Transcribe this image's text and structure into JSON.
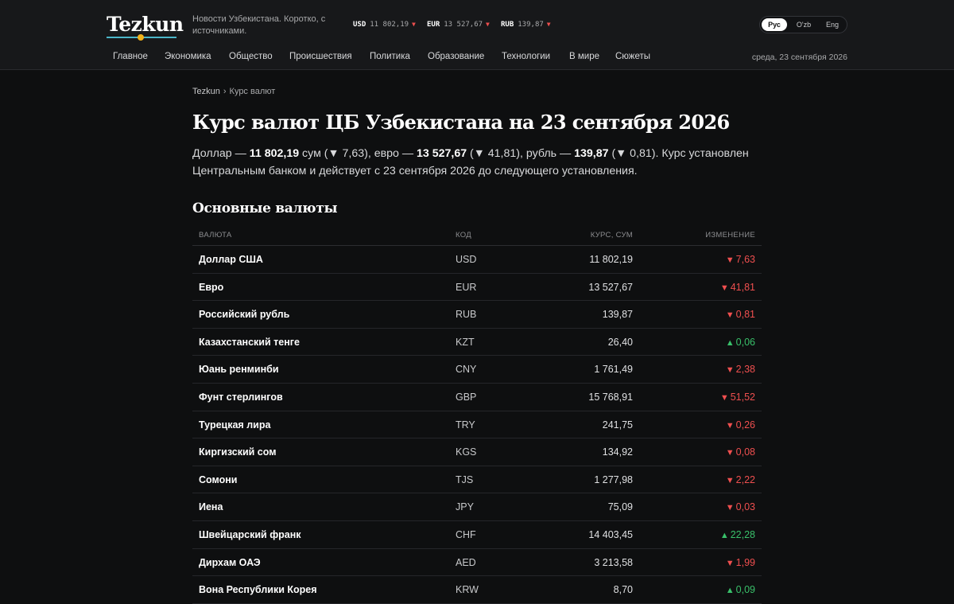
{
  "header": {
    "logo": "Tezkun",
    "tagline": "Новости Узбекистана. Коротко, с источниками.",
    "ticker": [
      {
        "code": "USD",
        "value": "11 802,19",
        "arrow": "▼"
      },
      {
        "code": "EUR",
        "value": "13 527,67",
        "arrow": "▼"
      },
      {
        "code": "RUB",
        "value": "139,87",
        "arrow": "▼"
      }
    ],
    "languages": [
      "Рус",
      "O'zb",
      "Eng"
    ],
    "active_language": "Рус",
    "nav": [
      "Главное",
      "Экономика",
      "Общество",
      "Происшествия",
      "Политика",
      "Образование",
      "Технологии",
      "В мире",
      "Сюжеты"
    ],
    "date": "среда, 23 сентября 2026"
  },
  "breadcrumb": {
    "home": "Tezkun",
    "separator": "›",
    "current": "Курс валют"
  },
  "page": {
    "title": "Курс валют ЦБ Узбекистана на 23 сентября 2026",
    "lead": {
      "p1": "Доллар — ",
      "usd": "11 802,19",
      "p2": " сум (▼ 7,63), евро — ",
      "eur": "13 527,67",
      "p3": " (▼ 41,81), рубль — ",
      "rub": "139,87",
      "p4": " (▼ 0,81). Курс установлен Центральным банком и действует с 23 сентября 2026 до следующего установления."
    },
    "section_title": "Основные валюты"
  },
  "table": {
    "headers": {
      "currency": "ВАЛЮТА",
      "code": "КОД",
      "rate": "КУРС, СУМ",
      "change": "ИЗМЕНЕНИЕ"
    },
    "rows": [
      {
        "name": "Доллар США",
        "code": "USD",
        "rate": "11 802,19",
        "dir": "down",
        "arrow": "▼",
        "change": "7,63"
      },
      {
        "name": "Евро",
        "code": "EUR",
        "rate": "13 527,67",
        "dir": "down",
        "arrow": "▼",
        "change": "41,81"
      },
      {
        "name": "Российский рубль",
        "code": "RUB",
        "rate": "139,87",
        "dir": "down",
        "arrow": "▼",
        "change": "0,81"
      },
      {
        "name": "Казахстанский тенге",
        "code": "KZT",
        "rate": "26,40",
        "dir": "up",
        "arrow": "▲",
        "change": "0,06"
      },
      {
        "name": "Юань ренминби",
        "code": "CNY",
        "rate": "1 761,49",
        "dir": "down",
        "arrow": "▼",
        "change": "2,38"
      },
      {
        "name": "Фунт стерлингов",
        "code": "GBP",
        "rate": "15 768,91",
        "dir": "down",
        "arrow": "▼",
        "change": "51,52"
      },
      {
        "name": "Турецкая лира",
        "code": "TRY",
        "rate": "241,75",
        "dir": "down",
        "arrow": "▼",
        "change": "0,26"
      },
      {
        "name": "Киргизский сом",
        "code": "KGS",
        "rate": "134,92",
        "dir": "down",
        "arrow": "▼",
        "change": "0,08"
      },
      {
        "name": "Сомони",
        "code": "TJS",
        "rate": "1 277,98",
        "dir": "down",
        "arrow": "▼",
        "change": "2,22"
      },
      {
        "name": "Иена",
        "code": "JPY",
        "rate": "75,09",
        "dir": "down",
        "arrow": "▼",
        "change": "0,03"
      },
      {
        "name": "Швейцарский франк",
        "code": "CHF",
        "rate": "14 403,45",
        "dir": "up",
        "arrow": "▲",
        "change": "22,28"
      },
      {
        "name": "Дирхам ОАЭ",
        "code": "AED",
        "rate": "3 213,58",
        "dir": "down",
        "arrow": "▼",
        "change": "1,99"
      },
      {
        "name": "Вона Республики Корея",
        "code": "KRW",
        "rate": "8,70",
        "dir": "up",
        "arrow": "▲",
        "change": "0,09"
      }
    ]
  },
  "colors": {
    "accent_line": "#4bb5c8",
    "accent_dot": "#f3b21a",
    "down": "#ef4f4f",
    "up": "#39c06a"
  }
}
